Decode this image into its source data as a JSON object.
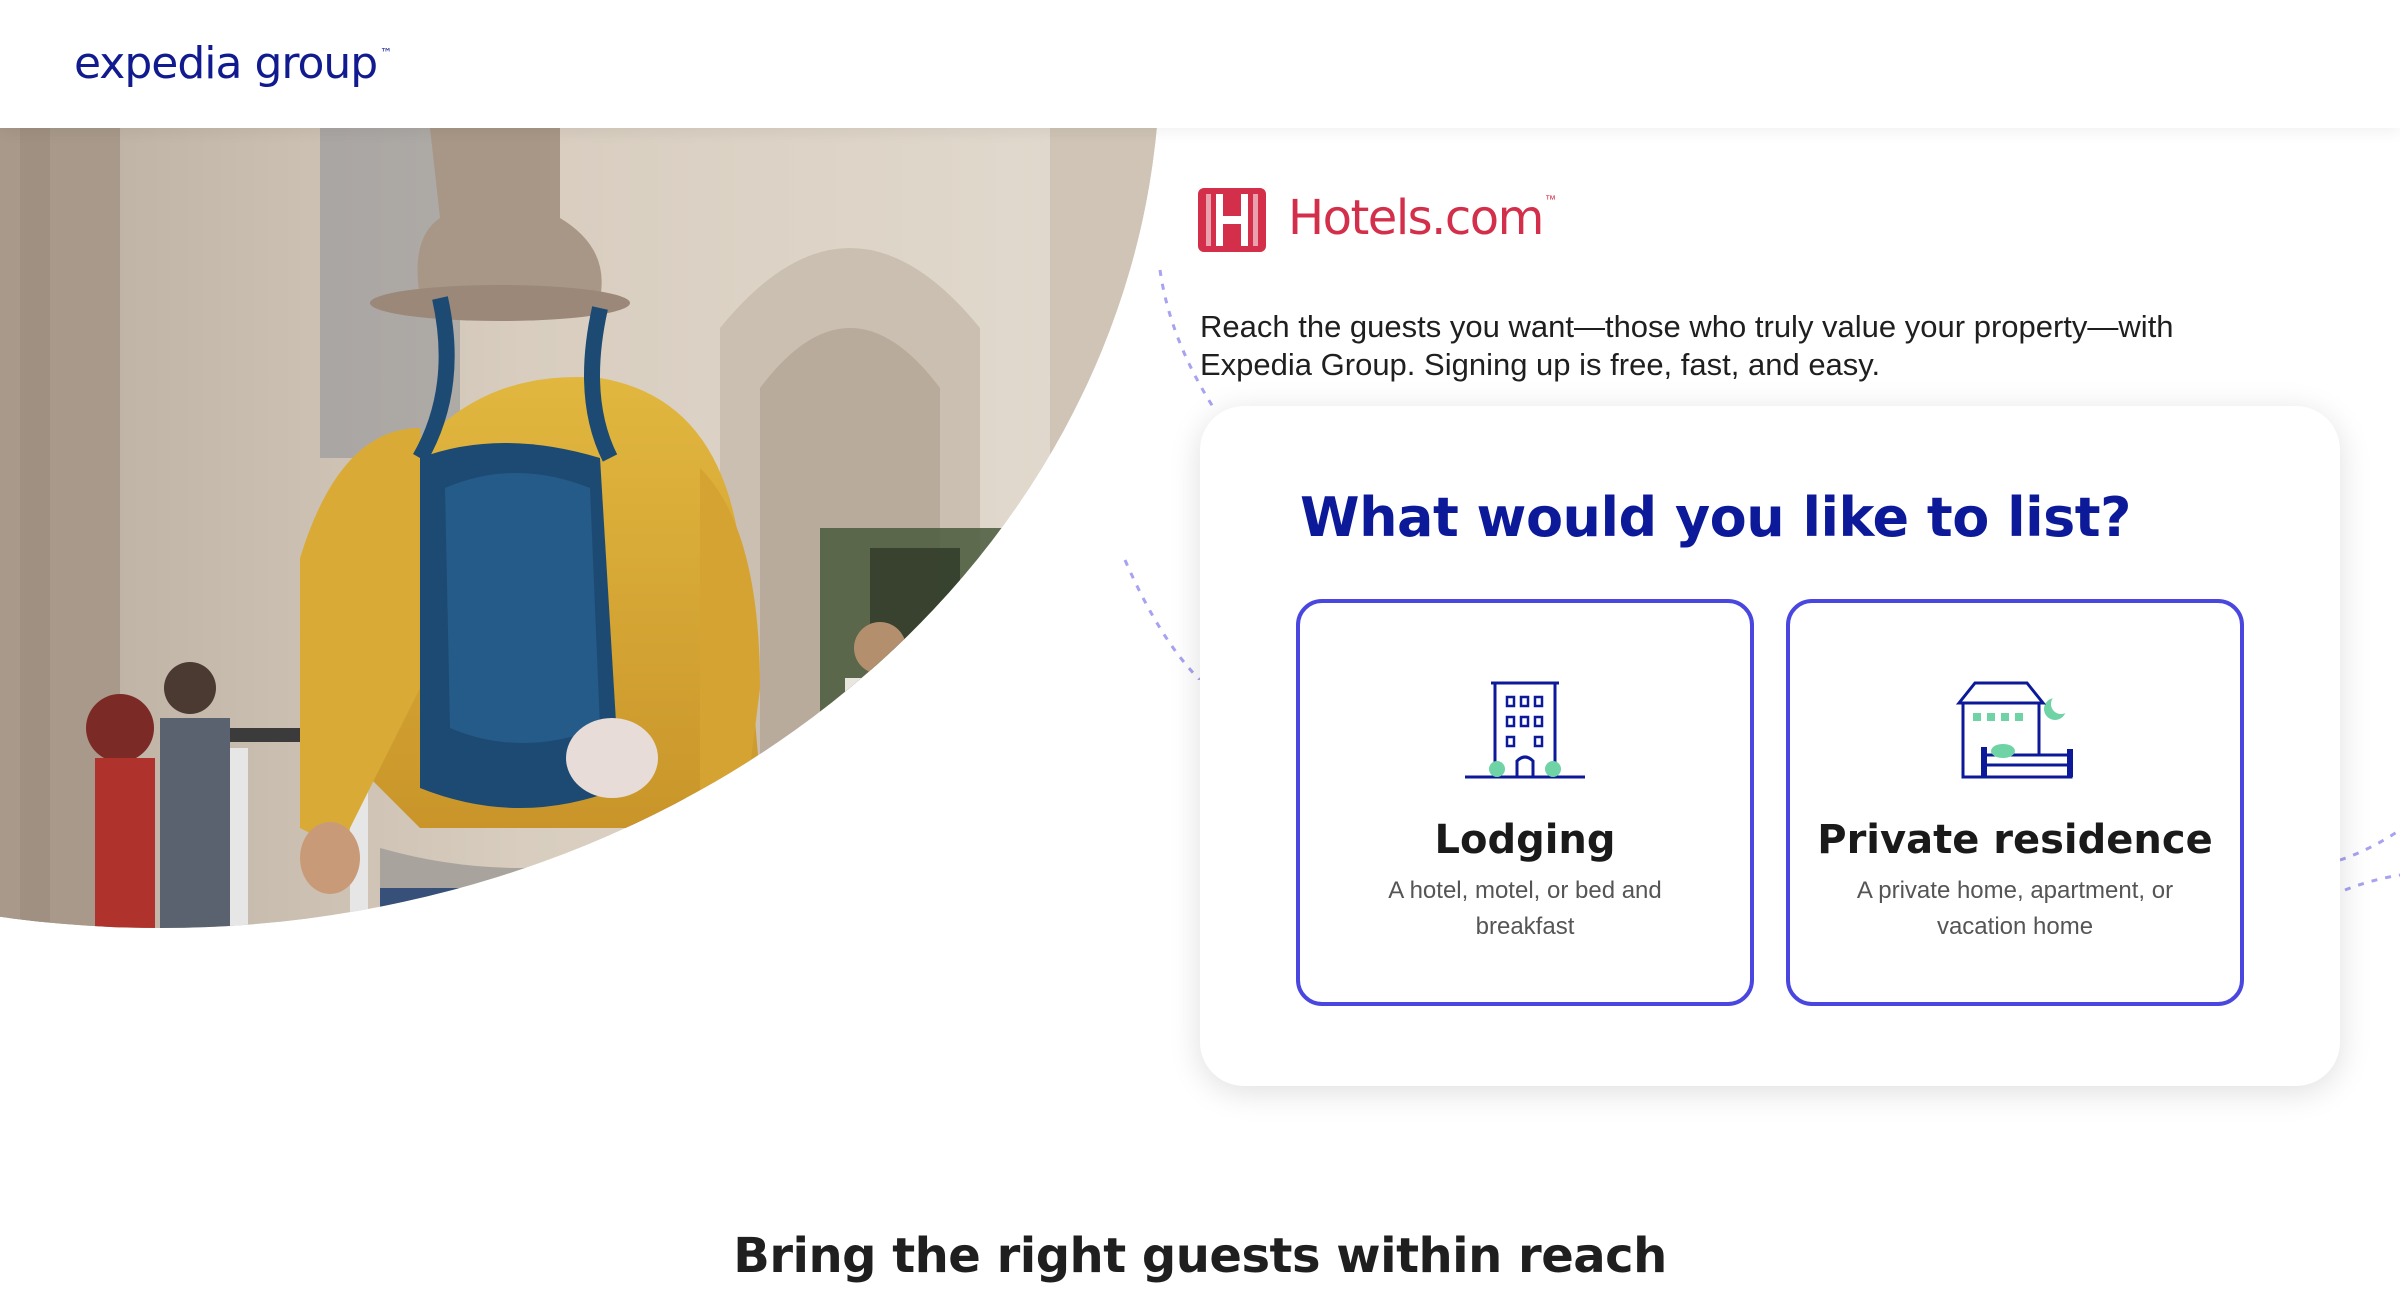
{
  "header": {
    "brand": "expedia group",
    "brand_tm": "™"
  },
  "partner": {
    "name": "Hotels.com",
    "tm": "™",
    "color": "#d32f4a"
  },
  "intro": "Reach the guests you want—those who truly value your property—with Expedia Group. Signing up is free, fast, and easy.",
  "card": {
    "heading": "What would you like to list?",
    "options": [
      {
        "title": "Lodging",
        "description": "A hotel, motel, or bed and breakfast",
        "icon": "hotel-building-icon"
      },
      {
        "title": "Private residence",
        "description": "A private home, apartment, or vacation home",
        "icon": "house-bed-icon"
      }
    ]
  },
  "section": {
    "title": "Bring the right guests within reach"
  },
  "colors": {
    "brand_navy": "#0c1a9a",
    "option_border": "#4a47e0",
    "icon_accent": "#6fd3a6",
    "dash_line": "#a7a3f0"
  }
}
